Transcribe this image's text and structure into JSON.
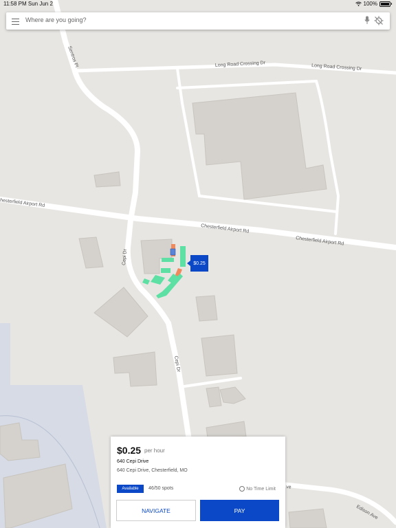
{
  "status_bar": {
    "time_date": "11:58 PM  Sun Jun 2",
    "battery": "100%"
  },
  "search": {
    "placeholder": "Where are you going?",
    "icons": [
      "menu-icon",
      "mic-icon",
      "location-off-icon"
    ]
  },
  "map": {
    "roads": {
      "long_road_1": "Long Road Crossing Dr",
      "long_road_2": "Long Road Crossing Dr",
      "sentros": "Sentros Pl",
      "chesterfield_1": "hesterfield Airport Rd",
      "chesterfield_2": "Chesterfield Airport Rd",
      "chesterfield_3": "Chesterfield Airport Rd",
      "cepi_1": "Cepi Dr",
      "cepi_2": "Cepi Dr",
      "edison": "Edison Ave",
      "ave_fragment": "ve"
    },
    "price_marker": "$0.25",
    "colors": {
      "spot_available": "#5ee0a4",
      "spot_occupied": "#f08a5d",
      "marker": "#0a48c7"
    }
  },
  "lot_card": {
    "price": "$0.25",
    "price_unit": "per hour",
    "name": "640 Cepi Drive",
    "address": "640 Cepi Drive, Chesterfield, MO",
    "status": "Available",
    "spots": "46/50 spots",
    "time_limit": "No Time Limit",
    "navigate_label": "NAVIGATE",
    "pay_label": "PAY"
  }
}
